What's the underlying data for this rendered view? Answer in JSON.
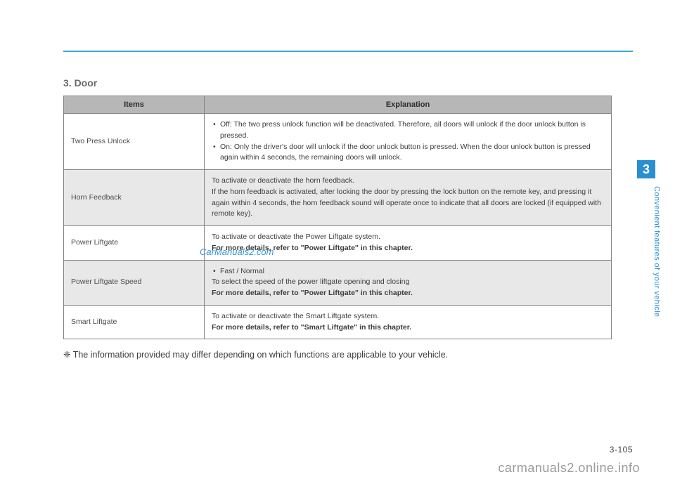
{
  "section_title": "3. Door",
  "table": {
    "headers": {
      "items": "Items",
      "explanation": "Explanation"
    },
    "rows": [
      {
        "item": "Two Press Unlock",
        "bullets": [
          "Off: The two press unlock function will be deactivated. Therefore, all doors will unlock if the door unlock button is pressed.",
          "On: Only the driver's door will unlock if the door unlock button is pressed. When the door unlock button is pressed again within 4 seconds, the remaining doors will unlock."
        ]
      },
      {
        "item": "Horn Feedback",
        "lines": [
          "To activate or deactivate the horn feedback.",
          "If the horn feedback is activated, after locking the door by pressing the lock button on the remote key, and pressing it again within 4 seconds, the horn feedback sound will operate once to indicate that all doors are locked (if equipped with remote key)."
        ]
      },
      {
        "item": "Power Liftgate",
        "line": "To activate or deactivate the Power Liftgate system.",
        "bold": "For more details, refer to \"Power Liftgate\" in this chapter."
      },
      {
        "item": "Power Liftgate Speed",
        "bullet": "Fast / Normal",
        "line": "To select the speed of the power liftgate opening and closing",
        "bold": "For more details, refer to \"Power Liftgate\" in this chapter."
      },
      {
        "item": "Smart Liftgate",
        "line": "To activate or deactivate the Smart Liftgate system.",
        "bold": "For more details, refer to \"Smart Liftgate\" in this chapter."
      }
    ]
  },
  "footnote": "❈ The information provided may differ depending on which functions are applicable to your vehicle.",
  "side_tab": "3",
  "side_text": "Convenient features of your vehicle",
  "page_number": "3-105",
  "watermarks": {
    "cm2": "CarManuals2.com",
    "bottom": "carmanuals2.online.info"
  }
}
